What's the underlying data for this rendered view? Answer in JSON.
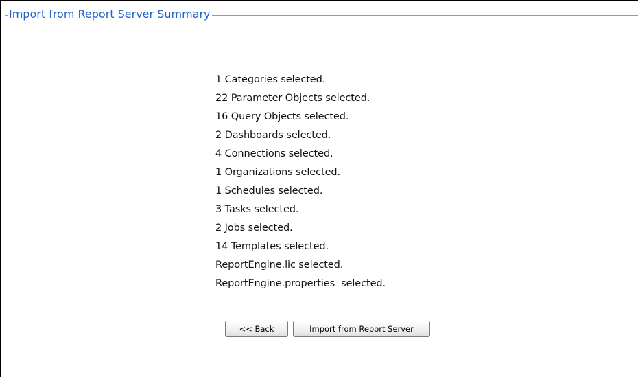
{
  "panel": {
    "title": "Import from Report Server Summary"
  },
  "summary": {
    "items": [
      "1 Categories selected.",
      "22 Parameter Objects selected.",
      "16 Query Objects selected.",
      "2 Dashboards selected.",
      "4 Connections selected.",
      "1 Organizations selected.",
      "1 Schedules selected.",
      "3 Tasks selected.",
      "2 Jobs selected.",
      "14 Templates selected.",
      "ReportEngine.lic selected.",
      "ReportEngine.properties  selected."
    ]
  },
  "actions": {
    "back_label": "<< Back",
    "import_label": "Import from Report Server"
  },
  "colors": {
    "title": "#1f63c7",
    "text": "#111111"
  }
}
